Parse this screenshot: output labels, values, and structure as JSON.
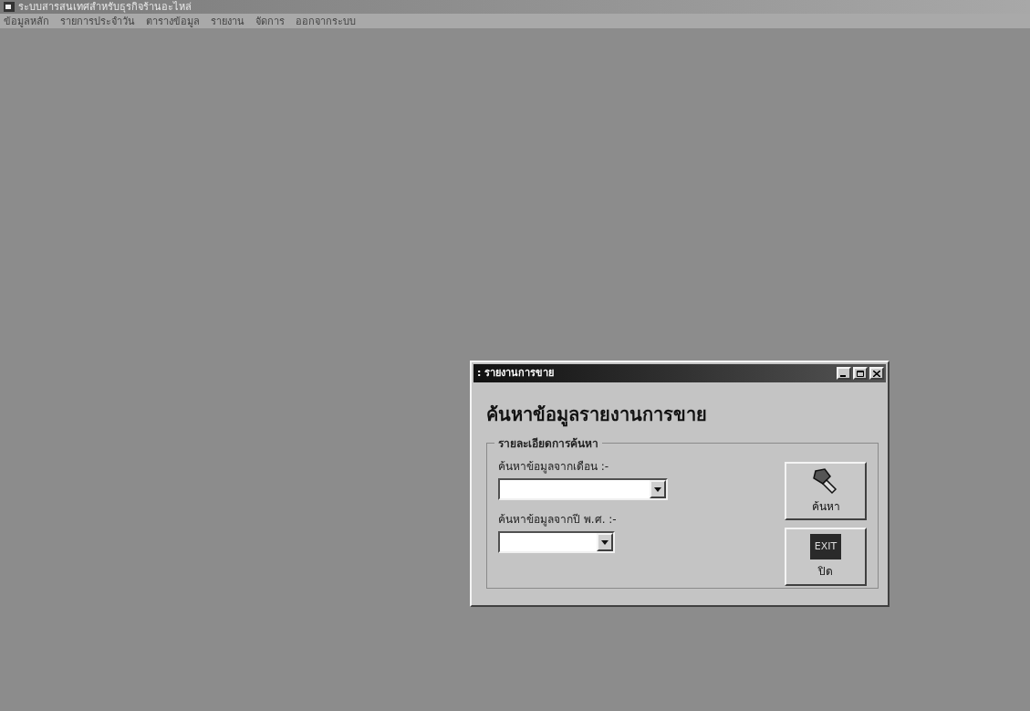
{
  "window": {
    "title": "ระบบสารสนเทศสำหรับธุรกิจร้านอะไหล่"
  },
  "menu": [
    "ข้อมูลหลัก",
    "รายการประจำวัน",
    "ตารางข้อมูล",
    "รายงาน",
    "จัดการ",
    "ออกจากระบบ"
  ],
  "dialog": {
    "title": ": รายงานการขาย",
    "heading": "ค้นหาข้อมูลรายงานการขาย",
    "group_label": "รายละเอียดการค้นหา",
    "fields": [
      {
        "label": "ค้นหาข้อมูลจากเดือน :-",
        "kind": "wide"
      },
      {
        "label": "ค้นหาข้อมูลจากปี พ.ศ. :-",
        "kind": "narrow"
      }
    ],
    "buttons": [
      {
        "label": "ค้นหา",
        "kind": "search"
      },
      {
        "label": "ปิด",
        "kind": "exit",
        "icon_text": "EXIT"
      }
    ]
  }
}
